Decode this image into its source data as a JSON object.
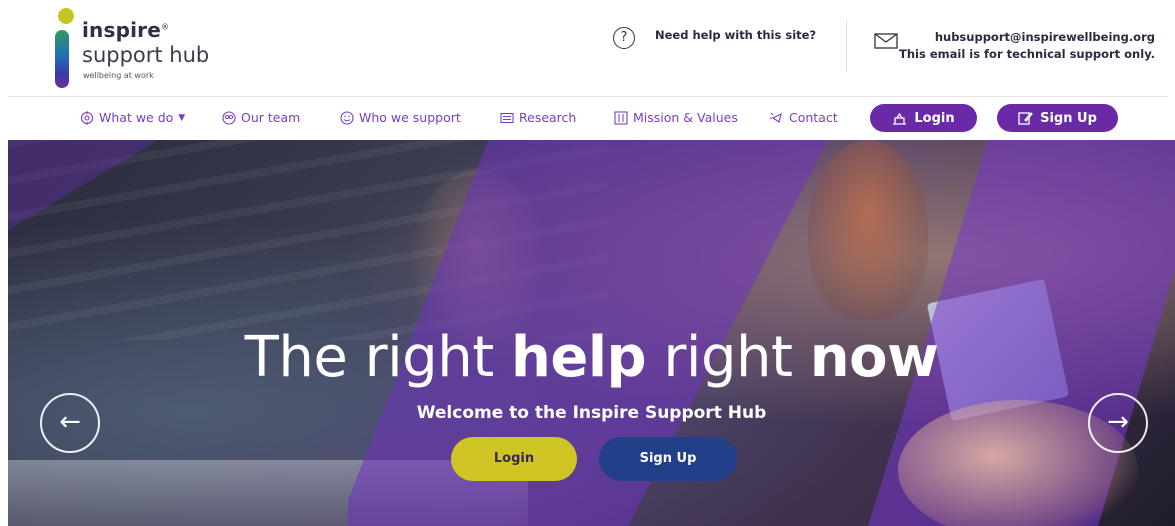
{
  "logo": {
    "word1": "inspire",
    "reg": "®",
    "word2": "support hub",
    "tagline": "wellbeing at work"
  },
  "help": {
    "icon": "question-circle-icon",
    "text": "Need help with this site?"
  },
  "support": {
    "icon": "envelope-icon",
    "email": "hubsupport@inspirewellbeing.org",
    "note": "This email is for technical support only."
  },
  "nav": {
    "items": [
      {
        "label": "What we do",
        "icon": "target-icon",
        "has_dropdown": true
      },
      {
        "label": "Our team",
        "icon": "team-icon"
      },
      {
        "label": "Who we support",
        "icon": "smiley-icon"
      },
      {
        "label": "Research",
        "icon": "research-icon"
      },
      {
        "label": "Mission & Values",
        "icon": "mission-icon"
      },
      {
        "label": "Contact",
        "icon": "contact-icon"
      }
    ],
    "login_label": "Login",
    "signup_label": "Sign Up"
  },
  "hero": {
    "title_part1": "The right ",
    "title_bold1": "help",
    "title_part2": " right ",
    "title_bold2": "now",
    "subtitle": "Welcome to the Inspire Support Hub",
    "login_label": "Login",
    "signup_label": "Sign Up",
    "prev_icon": "arrow-left-icon",
    "next_icon": "arrow-right-icon"
  },
  "colors": {
    "accent": "#6a2aa8",
    "nav_text": "#7a3fc0",
    "login_button": "#cfc626",
    "signup_button": "#223f8a",
    "logo_dot": "#c6c622"
  }
}
